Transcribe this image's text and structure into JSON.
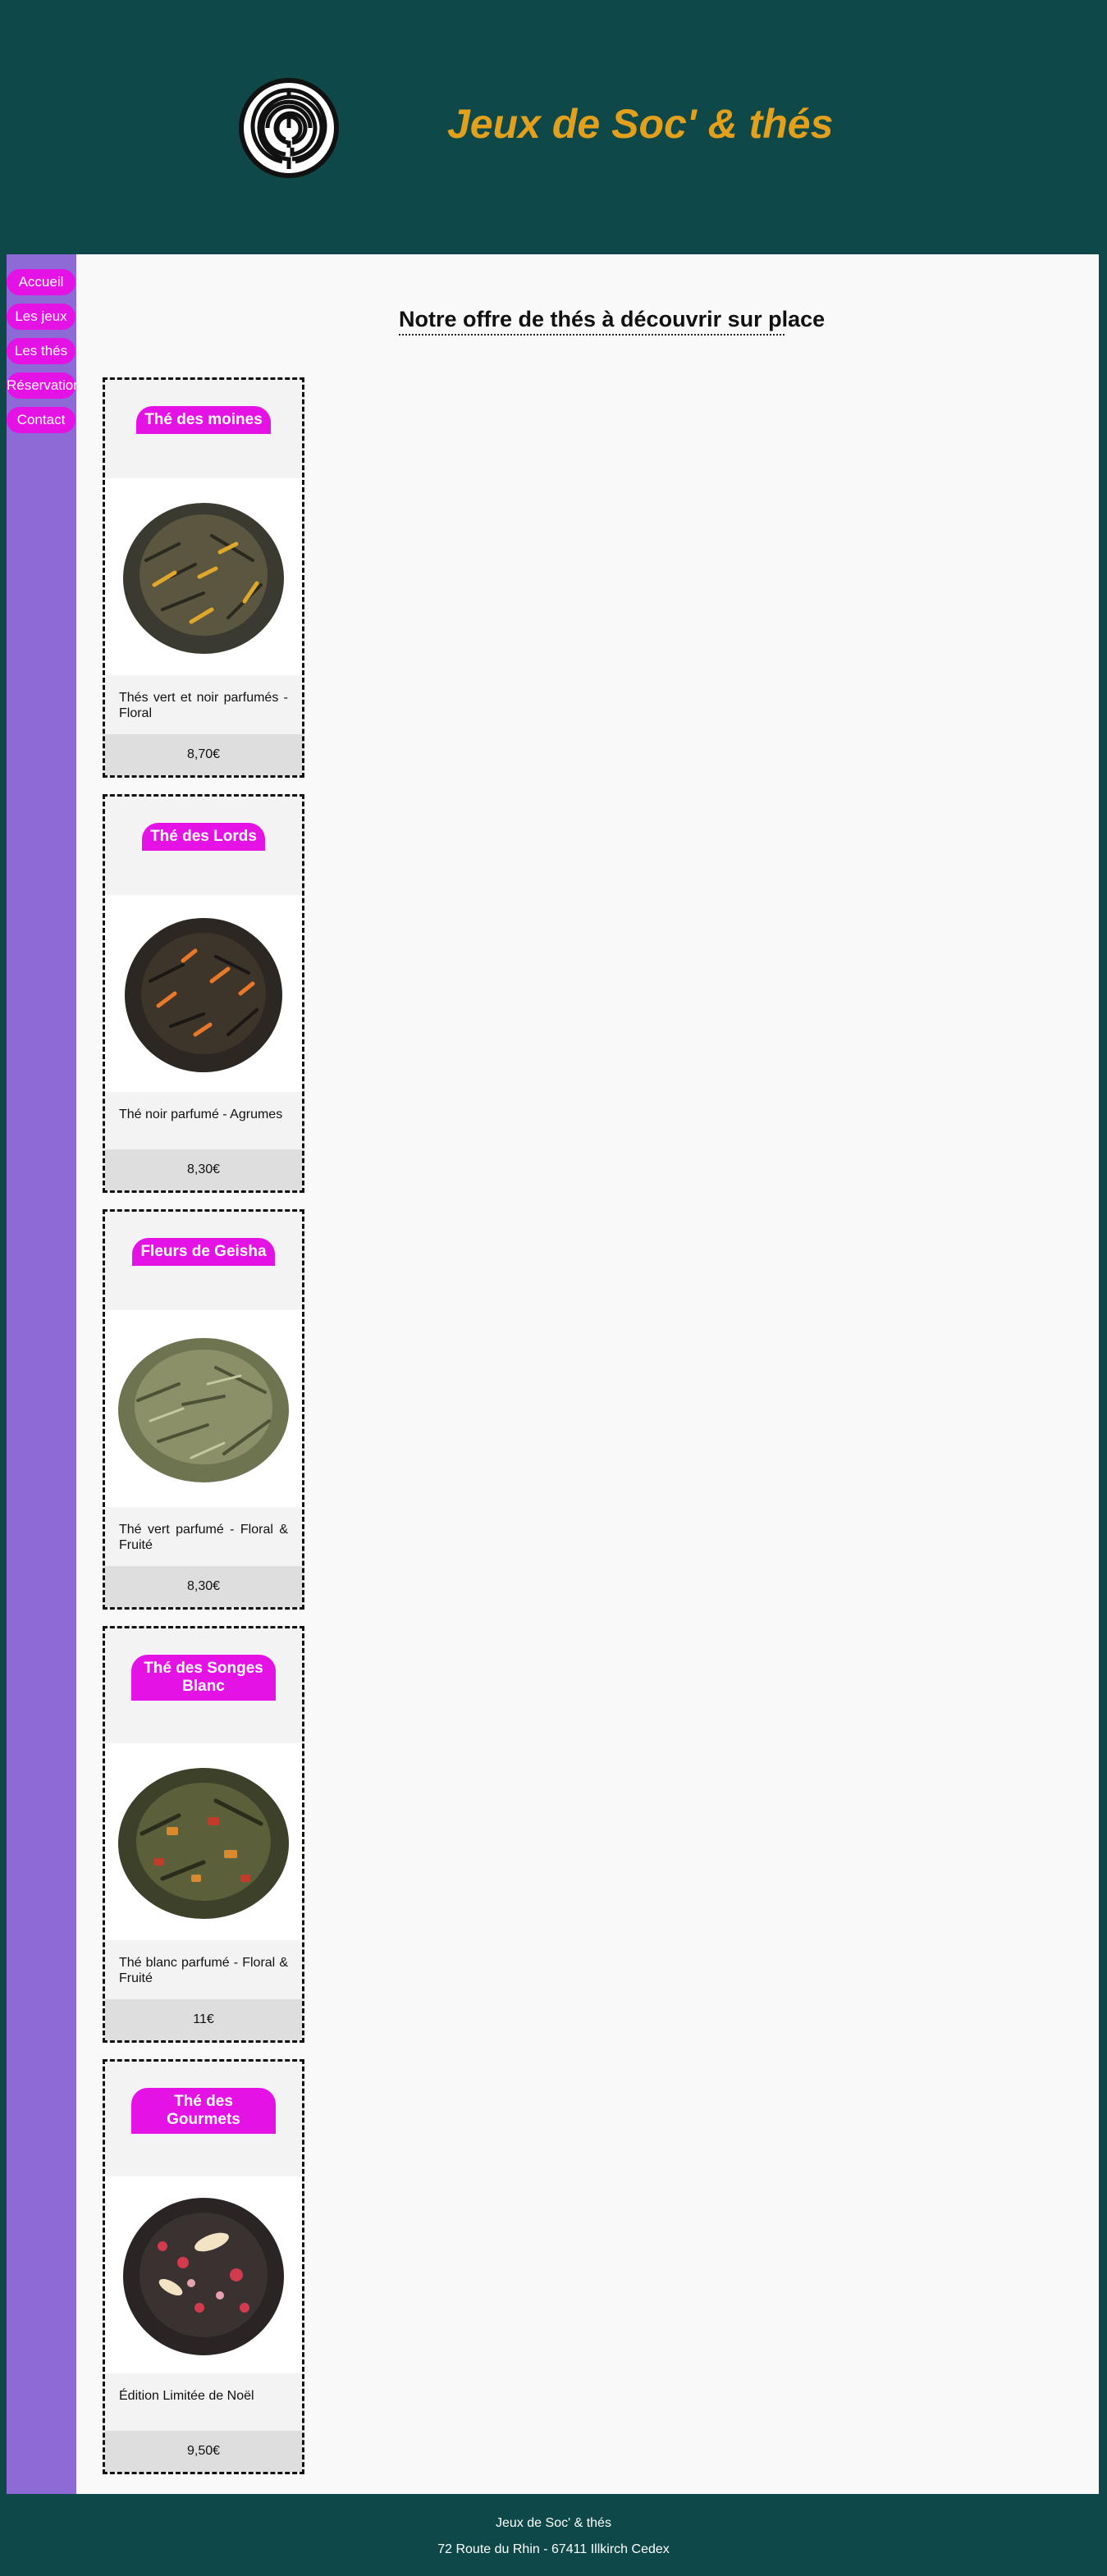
{
  "header": {
    "title": "Jeux de Soc' & thés",
    "logo_icon": "labyrinth-logo-icon"
  },
  "nav": {
    "items": [
      {
        "label": "Accueil"
      },
      {
        "label": "Les jeux"
      },
      {
        "label": "Les thés"
      },
      {
        "label": "Réservation"
      },
      {
        "label": "Contact"
      }
    ]
  },
  "main": {
    "title": "Notre offre de thés à découvrir sur place",
    "teas": [
      {
        "name": "Thé des moines",
        "description": "Thés vert et noir parfumés - Floral",
        "price": "8,70€",
        "image": "tea-leaves-yellow-petals"
      },
      {
        "name": "Thé des Lords",
        "description": "Thé noir parfumé - Agrumes",
        "price": "8,30€",
        "image": "tea-leaves-orange-petals"
      },
      {
        "name": "Fleurs de Geisha",
        "description": "Thé vert parfumé - Floral & Fruité",
        "price": "8,30€",
        "image": "green-tea-leaves"
      },
      {
        "name": "Thé des Songes Blanc",
        "description": "Thé blanc parfumé - Floral & Fruité",
        "price": "11€",
        "image": "white-tea-fruit-pieces"
      },
      {
        "name": "Thé des Gourmets",
        "description": "Édition Limitée de Noël",
        "price": "9,50€",
        "image": "black-tea-almonds-rose"
      }
    ]
  },
  "footer": {
    "name": "Jeux de Soc' & thés",
    "address": "72 Route du Rhin - 67411 Illkirch Cedex"
  },
  "colors": {
    "background": "#0f4849",
    "accent_title": "#e3a01c",
    "nav_pill": "#e512e5",
    "sidebar": "#8d6ad6"
  }
}
